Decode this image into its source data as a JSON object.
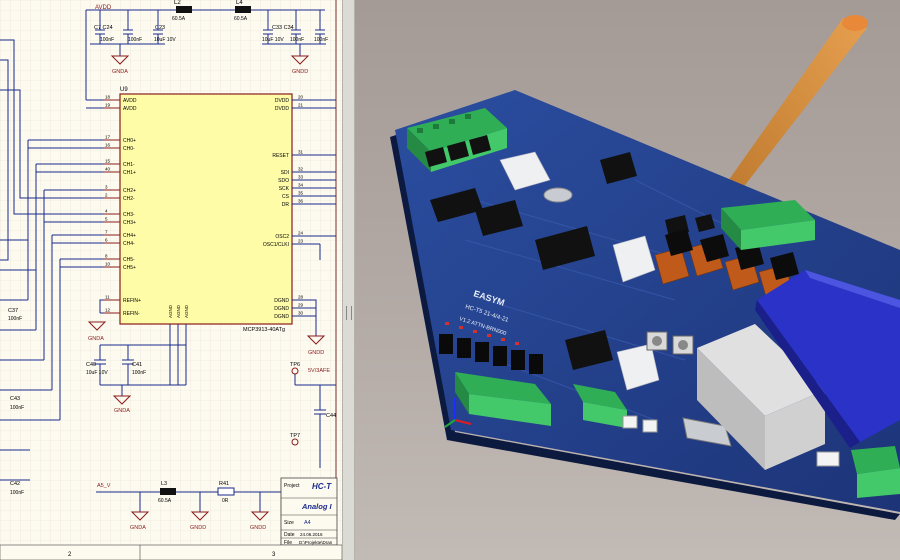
{
  "schematic": {
    "chip": {
      "ref": "U9",
      "part": "MCP3913-40ATg",
      "left_pins": [
        {
          "num": "18",
          "name": "AVDD"
        },
        {
          "num": "19",
          "name": "AVDD"
        },
        {
          "num": "17",
          "name": "CH0+"
        },
        {
          "num": "16",
          "name": "CH0-"
        },
        {
          "num": "15",
          "name": "CH1-"
        },
        {
          "num": "40",
          "name": "CH1+"
        },
        {
          "num": "3",
          "name": "CH2+"
        },
        {
          "num": "2",
          "name": "CH2-"
        },
        {
          "num": "4",
          "name": "CH3-"
        },
        {
          "num": "5",
          "name": "CH3+"
        },
        {
          "num": "7",
          "name": "CH4+"
        },
        {
          "num": "6",
          "name": "CH4-"
        },
        {
          "num": "8",
          "name": "CH5-"
        },
        {
          "num": "10",
          "name": "CH5+"
        },
        {
          "num": "11",
          "name": "REFIN+"
        },
        {
          "num": "12",
          "name": "REFIN-"
        }
      ],
      "right_pins": [
        {
          "num": "20",
          "name": "DVDD"
        },
        {
          "num": "21",
          "name": "DVDD"
        },
        {
          "num": "31",
          "name": "RESET"
        },
        {
          "num": "32",
          "name": "SDI"
        },
        {
          "num": "33",
          "name": "SDO"
        },
        {
          "num": "34",
          "name": "SCK"
        },
        {
          "num": "35",
          "name": "CS"
        },
        {
          "num": "36",
          "name": "DR"
        },
        {
          "num": "24",
          "name": "OSC2"
        },
        {
          "num": "23",
          "name": "OSC1/CLKI"
        },
        {
          "num": "28",
          "name": "DGND"
        },
        {
          "num": "29",
          "name": "DGND"
        },
        {
          "num": "30",
          "name": "DGND"
        }
      ],
      "bottom_pins": [
        "AGND",
        "AGND",
        "AGND"
      ]
    },
    "labels": {
      "avdd": "AVDD",
      "c_top_left": "C7 C24",
      "cap_100nf_a": "100nF",
      "cap_100nf_b": "100nF",
      "cap_10uf": "10uF 10V",
      "c23": "C23",
      "l2": "L2",
      "l2_val": "60.5A",
      "l4": "L4",
      "l4_val": "60.5A",
      "c_top_right": "C33  C34",
      "cap_tr_a": "10uF 10V",
      "cap_tr_b": "100nF",
      "cap_tr_c": "100nF",
      "gnd_a": "GNDA",
      "gnd_b": "GNDD",
      "c37": "C37",
      "c37_val": "100nF",
      "c40": "C40",
      "c40_val": "10uF 10V",
      "c41": "C41",
      "c41_val": "100nF",
      "c43": "C43",
      "c43_val": "100nF",
      "c42": "C42",
      "c42_val": "100nF",
      "tp6": "TP6",
      "vref": "5V/3AFE",
      "c44": "C44",
      "tp7": "TP7",
      "a5v": "A5_V",
      "l3": "L3",
      "l3_val": "60.5A",
      "r41": "R41",
      "r41_val": "0R",
      "gnd_bottom_a": "GNDA",
      "gnd_bottom_b": "GNDD",
      "gnd_bottom_c": "GNDD"
    },
    "title_block": {
      "project_label": "Project",
      "project_value": "HC-T",
      "title_value": "Analog I",
      "size_label": "Size",
      "size_value": "A4",
      "date_label": "Date",
      "date_value": "24.06.2016",
      "file_label": "File",
      "file_value": "D:\\Projekte\\Dran"
    },
    "zones": [
      "2",
      "3"
    ]
  },
  "board3d": {
    "silk_brand": "EASYM",
    "silk_lines": [
      "HC-T5 21-4/4-21",
      "V1.2  ATTN-BRN000"
    ],
    "colors": {
      "pcb": "#23408e",
      "connector": "#43c86a",
      "lcd_blue": "#2a32c8",
      "beam": "#e89a30"
    }
  }
}
